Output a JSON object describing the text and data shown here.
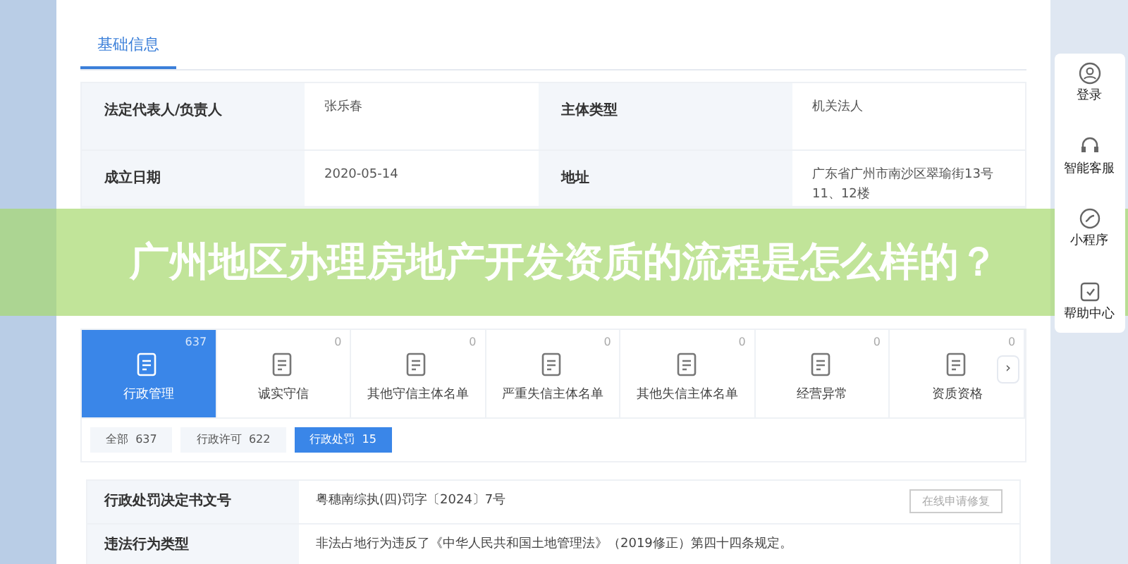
{
  "section_tab": {
    "label": "基础信息",
    "selected": true
  },
  "info_rows": [
    {
      "cells": [
        {
          "label": "法定代表人/负责人",
          "value": "张乐春"
        },
        {
          "label": "主体类型",
          "value": "机关法人"
        }
      ]
    },
    {
      "cells": [
        {
          "label": "成立日期",
          "value": "2020-05-14"
        },
        {
          "label": "地址",
          "value": "广东省广州市南沙区翠瑜街13号11、12楼"
        }
      ]
    }
  ],
  "categories": [
    {
      "label": "行政管理",
      "count": "637",
      "selected": true
    },
    {
      "label": "诚实守信",
      "count": "0",
      "selected": false
    },
    {
      "label": "其他守信主体名单",
      "count": "0",
      "selected": false
    },
    {
      "label": "严重失信主体名单",
      "count": "0",
      "selected": false
    },
    {
      "label": "其他失信主体名单",
      "count": "0",
      "selected": false
    },
    {
      "label": "经营异常",
      "count": "0",
      "selected": false
    },
    {
      "label": "资质资格",
      "count": "0",
      "selected": false
    }
  ],
  "filters": [
    {
      "label": "全部",
      "count": "637",
      "selected": false
    },
    {
      "label": "行政许可",
      "count": "622",
      "selected": false
    },
    {
      "label": "行政处罚",
      "count": "15",
      "selected": true
    }
  ],
  "detail_rows": [
    {
      "label": "行政处罚决定书文号",
      "value": "粤穗南综执(四)罚字〔2024〕7号"
    },
    {
      "label": "违法行为类型",
      "value": "非法占地行为违反了《中华人民共和国土地管理法》（2019修正）第四十四条规定。"
    }
  ],
  "repair_button": "在线申请修复",
  "next_arrow": "›",
  "side_menu": [
    "登录",
    "智能客服",
    "小程序",
    "帮助中心"
  ],
  "banner_title": "广州地区办理房地产开发资质的流程是怎么样的？"
}
